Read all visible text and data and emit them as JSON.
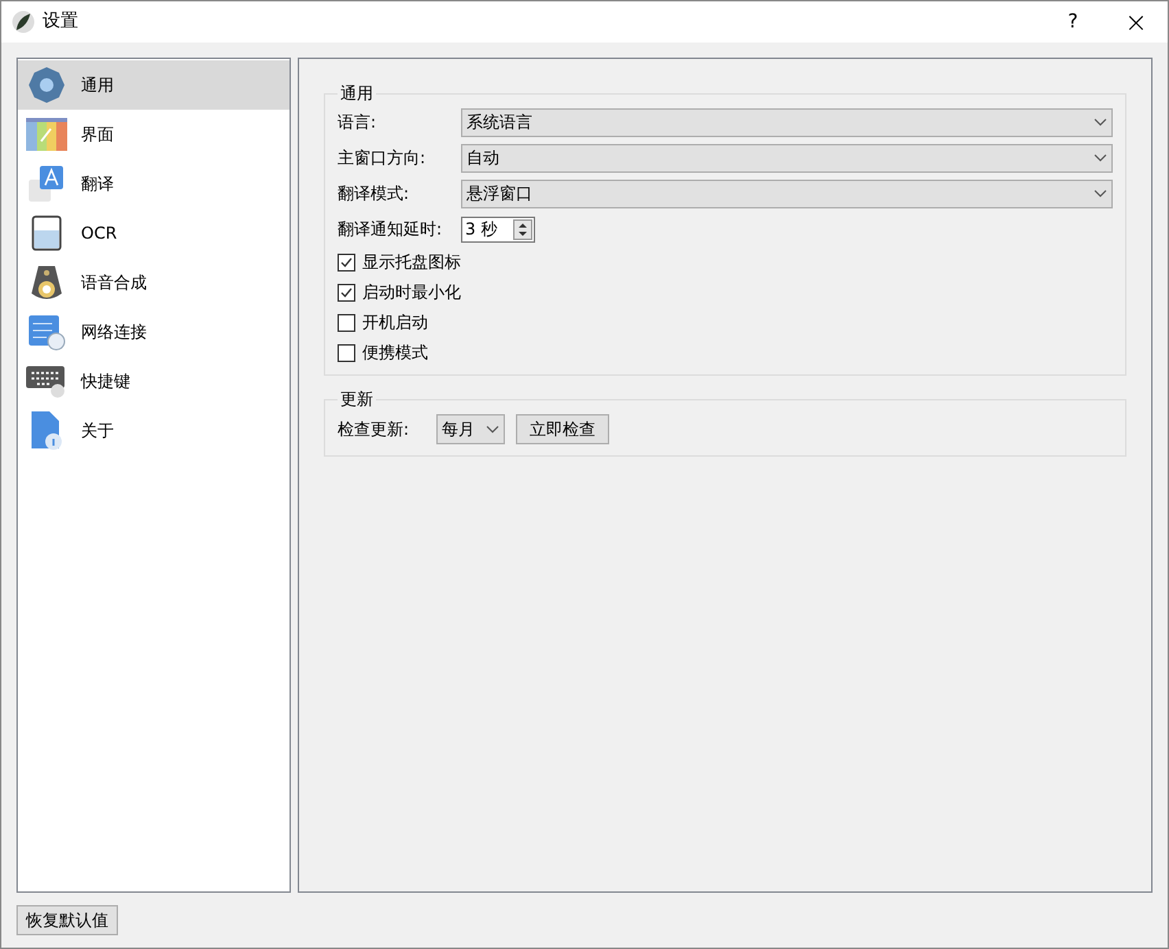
{
  "window": {
    "title": "设置",
    "help": "?",
    "close": "×"
  },
  "sidebar": {
    "items": [
      {
        "label": "通用",
        "kind": "gear",
        "selected": true
      },
      {
        "label": "界面",
        "kind": "palette",
        "selected": false
      },
      {
        "label": "翻译",
        "kind": "translate",
        "selected": false
      },
      {
        "label": "OCR",
        "kind": "ocr",
        "selected": false
      },
      {
        "label": "语音合成",
        "kind": "speaker",
        "selected": false
      },
      {
        "label": "网络连接",
        "kind": "network",
        "selected": false
      },
      {
        "label": "快捷键",
        "kind": "keyboard",
        "selected": false
      },
      {
        "label": "关于",
        "kind": "about",
        "selected": false
      }
    ]
  },
  "general": {
    "title": "通用",
    "fields": [
      {
        "kind": "select",
        "label": "语言:",
        "value": "系统语言"
      },
      {
        "kind": "select",
        "label": "主窗口方向:",
        "value": "自动"
      },
      {
        "kind": "select",
        "label": "翻译模式:",
        "value": "悬浮窗口"
      },
      {
        "kind": "spin",
        "label": "翻译通知延时:",
        "value": "3 秒"
      }
    ],
    "checkboxes": [
      {
        "label": "显示托盘图标",
        "checked": true
      },
      {
        "label": "启动时最小化",
        "checked": true
      },
      {
        "label": "开机启动",
        "checked": false
      },
      {
        "label": "便携模式",
        "checked": false
      }
    ]
  },
  "update": {
    "title": "更新",
    "label": "检查更新:",
    "frequency": "每月",
    "check_button": "立即检查"
  },
  "restore_button": "恢复默认值"
}
